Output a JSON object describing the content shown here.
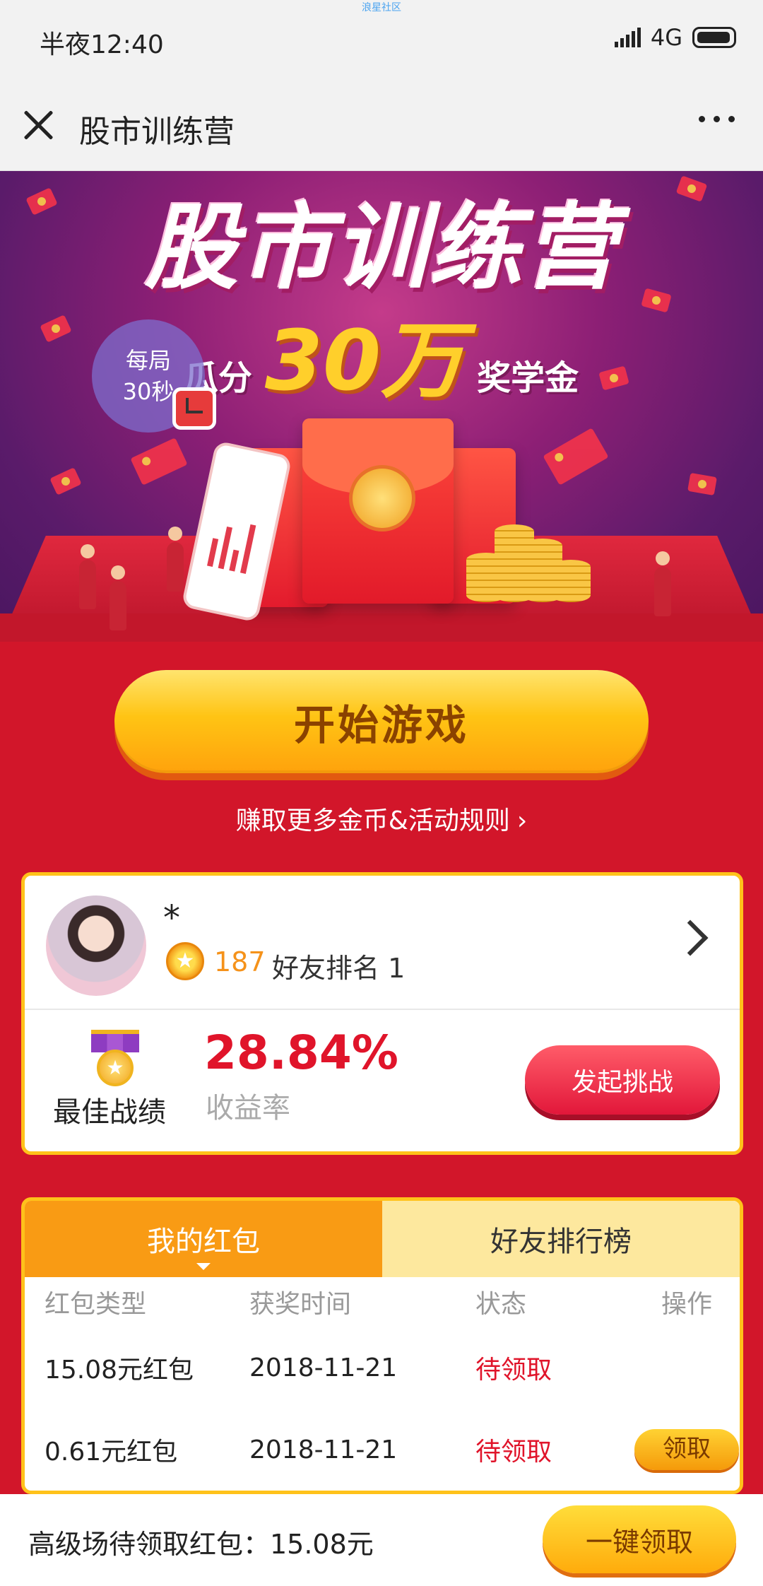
{
  "status_bar": {
    "watermark": "浪星社区",
    "time": "半夜12:40",
    "network": "4G"
  },
  "navbar": {
    "title": "股市训练营"
  },
  "banner": {
    "headline": "股市训练营",
    "sub_prefix": "瓜分",
    "sub_amount": "30万",
    "sub_suffix": "奖学金",
    "round_line1": "每局",
    "round_line2": "30秒"
  },
  "actions": {
    "start_game": "开始游戏",
    "rules_link": "赚取更多金币&活动规则",
    "rules_arrow": "›"
  },
  "profile": {
    "nickname": "*",
    "coin_glyph": "★",
    "coins": "187",
    "friend_rank": "好友排名 1",
    "best_label": "最佳战绩",
    "best_return": "28.84%",
    "return_label": "收益率",
    "challenge_button": "发起挑战"
  },
  "red_packets": {
    "tabs": [
      "我的红包",
      "好友排行榜"
    ],
    "columns": [
      "红包类型",
      "获奖时间",
      "状态",
      "操作"
    ],
    "rows": [
      {
        "type": "15.08元红包",
        "date": "2018-11-21",
        "status": "待领取",
        "action": ""
      },
      {
        "type": "0.61元红包",
        "date": "2018-11-21",
        "status": "待领取",
        "action": "领取"
      }
    ]
  },
  "bottom_bar": {
    "pending_text": "高级场待领取红包：15.08元",
    "claim_all": "一键领取"
  },
  "colors": {
    "page_background": "#d2162a",
    "accent_gold": "#ffc21a",
    "tab_active": "#f99b14",
    "tab_inactive": "#fde89e",
    "highlight_red": "#e0142a",
    "coin_orange": "#f5921a"
  },
  "icons": {
    "close": "close-icon",
    "more": "more-icon",
    "coin": "coin-icon",
    "medal": "medal-icon",
    "chevron": "chevron-right-icon",
    "clock": "clock-icon"
  }
}
